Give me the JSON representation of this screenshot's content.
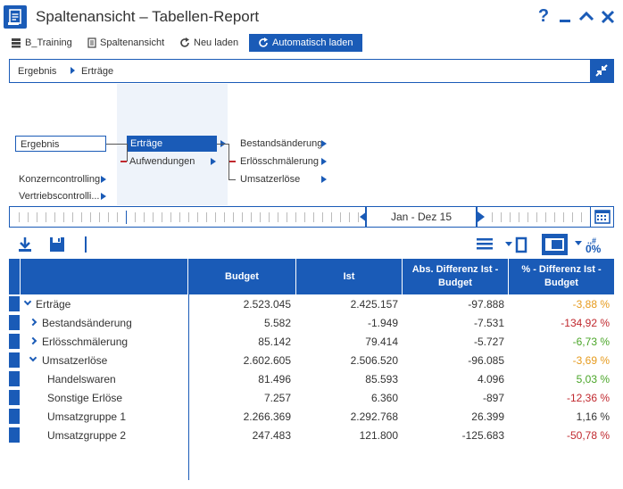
{
  "window": {
    "title": "Spaltenansicht – Tabellen-Report",
    "help_label": "?",
    "minimize_label": "—",
    "maximize_label": "^",
    "close_label": "✕"
  },
  "toolbar": {
    "items": [
      {
        "label": "B_Training",
        "icon": "database-icon"
      },
      {
        "label": "Spaltenansicht",
        "icon": "document-icon"
      },
      {
        "label": "Neu laden",
        "icon": "refresh-icon"
      },
      {
        "label": "Automatisch laden",
        "icon": "auto-refresh-icon"
      }
    ]
  },
  "breadcrumb": {
    "items": [
      "Ergebnis",
      "Erträge"
    ]
  },
  "tree": {
    "root": "Ergebnis",
    "root_siblings": [
      "Konzerncontrolling",
      "Vertriebscontrolli..."
    ],
    "level1": [
      "Erträge",
      "Aufwendungen"
    ],
    "level2": [
      "Bestandsänderung",
      "Erlösschmälerung",
      "Umsatzerlöse"
    ]
  },
  "timeline": {
    "period": "Jan - Dez 15"
  },
  "grid": {
    "columns": [
      "Budget",
      "Ist",
      "Abs. Differenz Ist - Budget",
      "% - Differenz Ist - Budget"
    ],
    "rows": [
      {
        "label": "Erträge",
        "budget": "2.523.045",
        "ist": "2.425.157",
        "abs": "-97.888",
        "pct": "-3,88 %",
        "pct_color": "orange"
      },
      {
        "label": "Bestandsänderung",
        "budget": "5.582",
        "ist": "-1.949",
        "abs": "-7.531",
        "pct": "-134,92 %",
        "pct_color": "red"
      },
      {
        "label": "Erlösschmälerung",
        "budget": "85.142",
        "ist": "79.414",
        "abs": "-5.727",
        "pct": "-6,73 %",
        "pct_color": "green"
      },
      {
        "label": "Umsatzerlöse",
        "budget": "2.602.605",
        "ist": "2.506.520",
        "abs": "-96.085",
        "pct": "-3,69 %",
        "pct_color": "orange"
      },
      {
        "label": "Handelswaren",
        "budget": "81.496",
        "ist": "85.593",
        "abs": "4.096",
        "pct": "5,03 %",
        "pct_color": "green"
      },
      {
        "label": "Sonstige Erlöse",
        "budget": "7.257",
        "ist": "6.360",
        "abs": "-897",
        "pct": "-12,36 %",
        "pct_color": "red"
      },
      {
        "label": "Umsatzgruppe 1",
        "budget": "2.266.369",
        "ist": "2.292.768",
        "abs": "26.399",
        "pct": "1,16 %",
        "pct_color": "neutral"
      },
      {
        "label": "Umsatzgruppe 2",
        "budget": "247.483",
        "ist": "121.800",
        "abs": "-125.683",
        "pct": "-50,78 %",
        "pct_color": "red"
      }
    ]
  },
  "colors": {
    "accent": "#1a5bb7",
    "negative_red": "#c0282e",
    "warning_orange": "#e69a1c",
    "positive_green": "#4aa528"
  }
}
